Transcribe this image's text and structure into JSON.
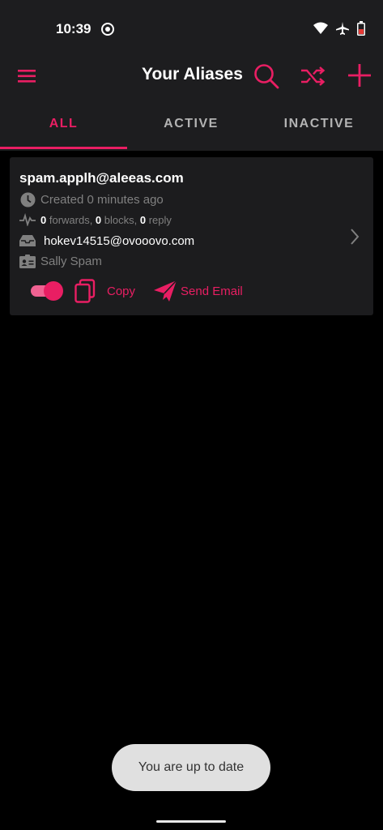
{
  "status_bar": {
    "time": "10:39"
  },
  "app_bar": {
    "title": "Your Aliases"
  },
  "tabs": [
    {
      "label": "ALL",
      "active": true
    },
    {
      "label": "ACTIVE",
      "active": false
    },
    {
      "label": "INACTIVE",
      "active": false
    }
  ],
  "alias": {
    "email": "spam.applh@aleeas.com",
    "created": "Created 0 minutes ago",
    "forwards_count": "0",
    "forwards_label": " forwards, ",
    "blocks_count": "0",
    "blocks_label": " blocks, ",
    "reply_count": "0",
    "reply_label": " reply",
    "mailbox": "hokev14515@ovooovo.com",
    "name": "Sally Spam",
    "enabled": true,
    "copy_label": "Copy",
    "send_label": "Send Email"
  },
  "toast": {
    "message": "You are up to date"
  },
  "colors": {
    "accent": "#e91e63",
    "bar_bg": "#1d1d1f",
    "card_bg": "#1c1c1e",
    "muted": "#808080"
  }
}
